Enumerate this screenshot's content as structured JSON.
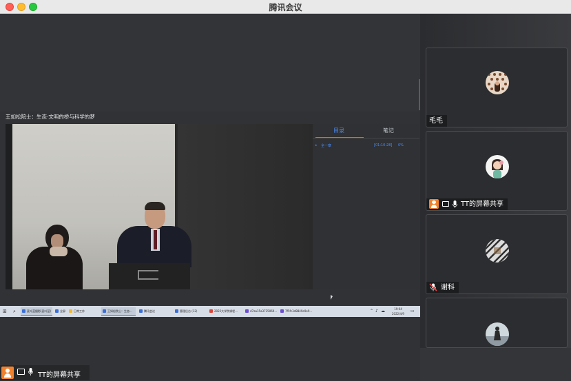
{
  "window": {
    "title": "腾讯会议"
  },
  "share": {
    "course_title": "王如松院士：生态·文明的桥与科学的梦",
    "panel": {
      "tabs": [
        "目录",
        "笔记"
      ],
      "toc": {
        "bullet": "▸",
        "chapter": "全一章",
        "duration": "[01:10:28]",
        "progress": "0%"
      }
    },
    "taskbar": {
      "items": [
        {
          "label": "麦叶蓝摄影(麦叶蓝)",
          "color": "#3a6fd8"
        },
        {
          "label": "全屏一下",
          "color": "#3a6fd8"
        },
        {
          "label": "日常工作",
          "color": "#f2b830"
        },
        {
          "label": "王如松院士：生态...",
          "color": "#3a6fd8"
        },
        {
          "label": "腾讯会议",
          "color": "#3a6fd8"
        },
        {
          "label": "管理后台 (12)",
          "color": "#3a6fd8"
        },
        {
          "label": "2022大学院课程...",
          "color": "#d8453a"
        },
        {
          "label": "d7aa15a3735069...",
          "color": "#6b4fd0"
        },
        {
          "label": "7f5fc3d8849e9e9...",
          "color": "#6b4fd0"
        }
      ],
      "clock_time": "19:04",
      "clock_date": "2022/4/9"
    }
  },
  "presenter": {
    "name": "TT的屏幕共享"
  },
  "participants": [
    {
      "name": "毛毛",
      "avatar": "tiled-pattern-avatar"
    },
    {
      "name": "TT的屏幕共享",
      "avatar": "cartoon-girl-avatar"
    },
    {
      "name": "谢科",
      "avatar": "diagonal-stripes-avatar"
    },
    {
      "name": "",
      "avatar": "person-silhouette-avatar"
    }
  ],
  "colors": {
    "accent": "#4b8df7",
    "presenter_badge": "#f0822f",
    "mic_off": "#e24a4a"
  }
}
